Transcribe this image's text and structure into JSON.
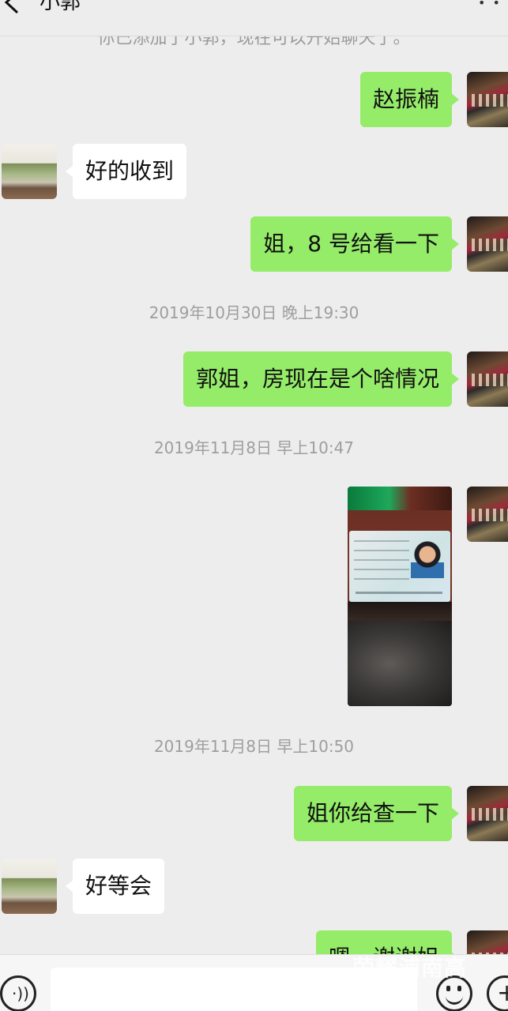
{
  "header": {
    "title": "小郭",
    "back_icon": "chevron-left-icon",
    "more_label": "• •"
  },
  "system_notice": "你已添加了小郭，现在可以开始聊天了。",
  "messages": [
    {
      "sender": "me",
      "text": "赵振楠"
    },
    {
      "sender": "other",
      "text": "好的收到"
    },
    {
      "sender": "me",
      "text": "姐，8 号给看一下"
    },
    {
      "timestamp": "2019年10月30日 晚上19:30"
    },
    {
      "sender": "me",
      "text": "郭姐，房现在是个啥情况"
    },
    {
      "timestamp": "2019年11月8日 早上10:47"
    },
    {
      "sender": "me",
      "type": "image"
    },
    {
      "timestamp": "2019年11月8日 早上10:50"
    },
    {
      "sender": "me",
      "text": "姐你给查一下"
    },
    {
      "sender": "other",
      "text": "好等会"
    },
    {
      "sender": "me",
      "text": "嗯，谢谢姐"
    }
  ],
  "input_bar": {
    "voice_icon": "voice-icon",
    "emoji_icon": "emoji-icon",
    "plus_icon": "plus-icon",
    "voice_glyph": "·))",
    "plus_glyph": "+"
  },
  "watermark": "荣耀浦南高"
}
